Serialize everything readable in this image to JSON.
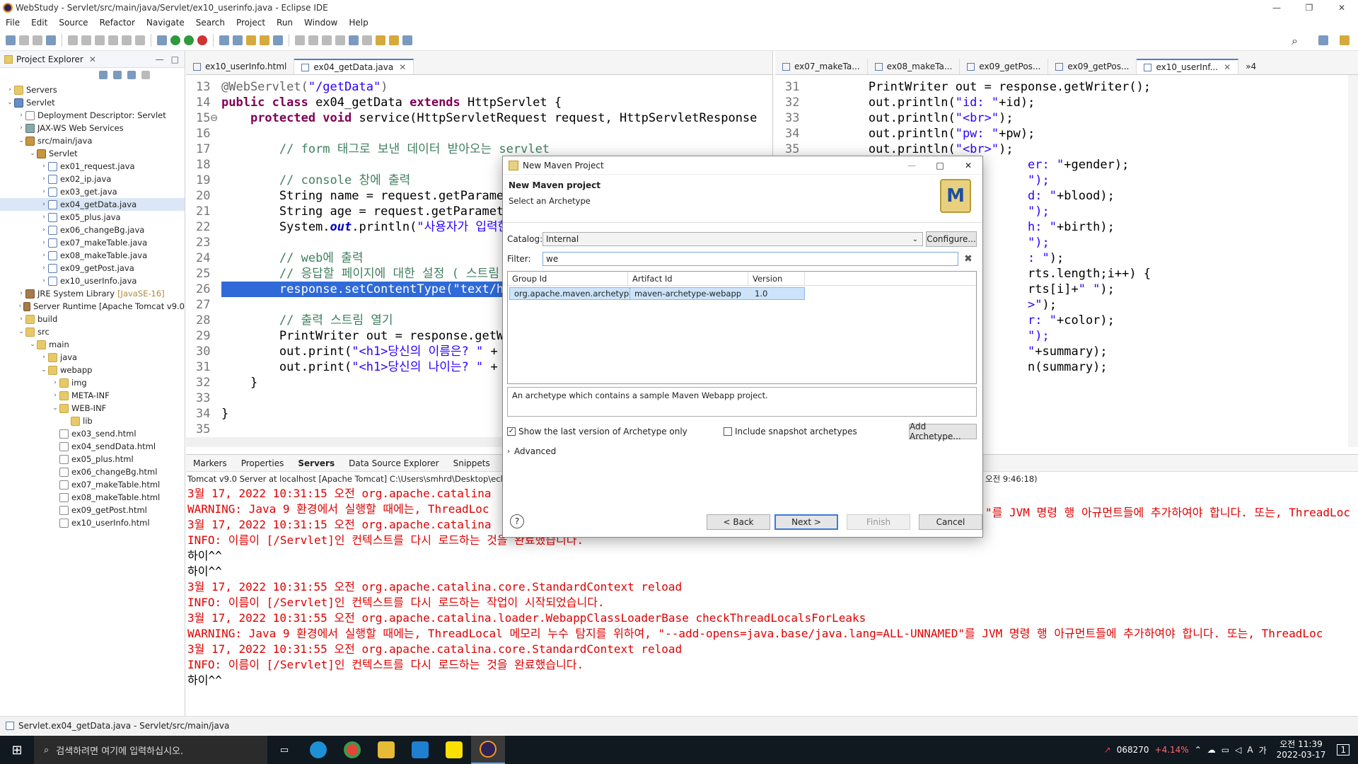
{
  "window": {
    "title": "WebStudy - Servlet/src/main/java/Servlet/ex10_userinfo.java - Eclipse IDE"
  },
  "menu": [
    "File",
    "Edit",
    "Source",
    "Refactor",
    "Navigate",
    "Search",
    "Project",
    "Run",
    "Window",
    "Help"
  ],
  "explorer": {
    "title": "Project Explorer",
    "tree": [
      {
        "label": "Servers",
        "depth": 0,
        "chev": "›",
        "icon": "fold"
      },
      {
        "label": "Servlet",
        "depth": 0,
        "chev": "⌄",
        "icon": "prj"
      },
      {
        "label": "Deployment Descriptor: Servlet",
        "depth": 1,
        "chev": "›",
        "icon": "html"
      },
      {
        "label": "JAX-WS Web Services",
        "depth": 1,
        "chev": "›",
        "icon": "srv"
      },
      {
        "label": "src/main/java",
        "depth": 1,
        "chev": "⌄",
        "icon": "pkg"
      },
      {
        "label": "Servlet",
        "depth": 2,
        "chev": "⌄",
        "icon": "pkg"
      },
      {
        "label": "ex01_request.java",
        "depth": 3,
        "chev": "›",
        "icon": "java"
      },
      {
        "label": "ex02_ip.java",
        "depth": 3,
        "chev": "›",
        "icon": "java"
      },
      {
        "label": "ex03_get.java",
        "depth": 3,
        "chev": "›",
        "icon": "java"
      },
      {
        "label": "ex04_getData.java",
        "depth": 3,
        "chev": "›",
        "icon": "java",
        "selected": true
      },
      {
        "label": "ex05_plus.java",
        "depth": 3,
        "chev": "›",
        "icon": "java"
      },
      {
        "label": "ex06_changeBg.java",
        "depth": 3,
        "chev": "›",
        "icon": "java"
      },
      {
        "label": "ex07_makeTable.java",
        "depth": 3,
        "chev": "›",
        "icon": "java"
      },
      {
        "label": "ex08_makeTable.java",
        "depth": 3,
        "chev": "›",
        "icon": "java"
      },
      {
        "label": "ex09_getPost.java",
        "depth": 3,
        "chev": "›",
        "icon": "java"
      },
      {
        "label": "ex10_userInfo.java",
        "depth": 3,
        "chev": "›",
        "icon": "java"
      },
      {
        "label": "JRE System Library",
        "suffix": "[JavaSE-16]",
        "depth": 1,
        "chev": "›",
        "icon": "lib"
      },
      {
        "label": "Server Runtime [Apache Tomcat v9.0",
        "depth": 1,
        "chev": "›",
        "icon": "lib"
      },
      {
        "label": "build",
        "depth": 1,
        "chev": "›",
        "icon": "fold"
      },
      {
        "label": "src",
        "depth": 1,
        "chev": "⌄",
        "icon": "fold"
      },
      {
        "label": "main",
        "depth": 2,
        "chev": "⌄",
        "icon": "fold"
      },
      {
        "label": "java",
        "depth": 3,
        "chev": "›",
        "icon": "fold"
      },
      {
        "label": "webapp",
        "depth": 3,
        "chev": "⌄",
        "icon": "fold"
      },
      {
        "label": "img",
        "depth": 4,
        "chev": "›",
        "icon": "fold"
      },
      {
        "label": "META-INF",
        "depth": 4,
        "chev": "›",
        "icon": "fold"
      },
      {
        "label": "WEB-INF",
        "depth": 4,
        "chev": "⌄",
        "icon": "fold"
      },
      {
        "label": "lib",
        "depth": 5,
        "chev": "",
        "icon": "fold"
      },
      {
        "label": "ex03_send.html",
        "depth": 4,
        "chev": "",
        "icon": "html"
      },
      {
        "label": "ex04_sendData.html",
        "depth": 4,
        "chev": "",
        "icon": "html"
      },
      {
        "label": "ex05_plus.html",
        "depth": 4,
        "chev": "",
        "icon": "html"
      },
      {
        "label": "ex06_changeBg.html",
        "depth": 4,
        "chev": "",
        "icon": "html"
      },
      {
        "label": "ex07_makeTable.html",
        "depth": 4,
        "chev": "",
        "icon": "html"
      },
      {
        "label": "ex08_makeTable.html",
        "depth": 4,
        "chev": "",
        "icon": "html"
      },
      {
        "label": "ex09_getPost.html",
        "depth": 4,
        "chev": "",
        "icon": "html"
      },
      {
        "label": "ex10_userInfo.html",
        "depth": 4,
        "chev": "",
        "icon": "html"
      }
    ]
  },
  "editor1": {
    "tabs": [
      {
        "label": "ex10_userInfo.html",
        "active": false
      },
      {
        "label": "ex04_getData.java",
        "active": true
      }
    ]
  },
  "editor2": {
    "tabs": [
      {
        "label": "ex07_makeTa...",
        "active": false
      },
      {
        "label": "ex08_makeTa...",
        "active": false
      },
      {
        "label": "ex09_getPos...",
        "active": false
      },
      {
        "label": "ex09_getPos...",
        "active": false
      },
      {
        "label": "ex10_userInf...",
        "active": true
      }
    ],
    "overflow": "»4"
  },
  "console": {
    "tabs": [
      "Markers",
      "Properties",
      "Servers",
      "Data Source Explorer",
      "Snippets"
    ],
    "info": "Tomcat v9.0 Server at localhost [Apache Tomcat] C:\\Users\\smhrd\\Desktop\\ecli",
    "info_right": "오전 9:46:18)",
    "lines": [
      {
        "t": "3월 17, 2022 10:31:15 오전 org.apache.catalina",
        "c": "red"
      },
      {
        "t": "WARNING: Java 9 환경에서 실행할 때에는, ThreadLoc",
        "c": "red"
      },
      {
        "t": "3월 17, 2022 10:31:15 오전 org.apache.catalina",
        "c": "red"
      },
      {
        "t": "INFO: 이름이 [/Servlet]인 컨텍스트를 다시 로드하는 것을 완료했습니다.",
        "c": "red"
      },
      {
        "t": "하이^^",
        "c": "blk"
      },
      {
        "t": "하이^^",
        "c": "blk"
      },
      {
        "t": "3월 17, 2022 10:31:55 오전 org.apache.catalina.core.StandardContext reload",
        "c": "red"
      },
      {
        "t": "INFO: 이름이 [/Servlet]인 컨텍스트를 다시 로드하는 작업이 시작되었습니다.",
        "c": "red"
      },
      {
        "t": "3월 17, 2022 10:31:55 오전 org.apache.catalina.loader.WebappClassLoaderBase checkThreadLocalsForLeaks",
        "c": "red"
      },
      {
        "t": "WARNING: Java 9 환경에서 실행할 때에는, ThreadLocal 메모리 누수 탐지를 위하여, \"--add-opens=java.base/java.lang=ALL-UNNAMED\"를 JVM 명령 행 아규먼트들에 추가하여야 합니다. 또는, ThreadLoc",
        "c": "red"
      },
      {
        "t": "3월 17, 2022 10:31:55 오전 org.apache.catalina.core.StandardContext reload",
        "c": "red"
      },
      {
        "t": "INFO: 이름이 [/Servlet]인 컨텍스트를 다시 로드하는 것을 완료했습니다.",
        "c": "red"
      },
      {
        "t": "하이^^",
        "c": "blk"
      }
    ],
    "line2_right": "\"를 JVM 명령 행 아규먼트들에 추가하여야 합니다. 또는, ThreadLoc"
  },
  "status": {
    "text": "Servlet.ex04_getData.java - Servlet/src/main/java"
  },
  "dialog": {
    "title": "New Maven Project",
    "header": "New Maven project",
    "subheader": "Select an Archetype",
    "catalog_label": "Catalog:",
    "catalog_value": "Internal",
    "configure": "Configure...",
    "filter_label": "Filter:",
    "filter_value": "we",
    "columns": [
      "Group Id",
      "Artifact Id",
      "Version"
    ],
    "row": {
      "group": "org.apache.maven.archetypes",
      "artifact": "maven-archetype-webapp",
      "version": "1.0"
    },
    "description": "An archetype which contains a sample Maven Webapp project.",
    "show_last": "Show the last version of Archetype only",
    "include_snap": "Include snapshot archetypes",
    "add_archetype": "Add Archetype...",
    "advanced": "Advanced",
    "back": "< Back",
    "next": "Next >",
    "finish": "Finish",
    "cancel": "Cancel"
  },
  "taskbar": {
    "search": "검색하려면 여기에 입력하십시오.",
    "stock_code": "068270",
    "stock_change": "+4.14%",
    "time": "오전 11:39",
    "date": "2022-03-17",
    "notif": "1",
    "ime": "가",
    "ime2": "A"
  }
}
